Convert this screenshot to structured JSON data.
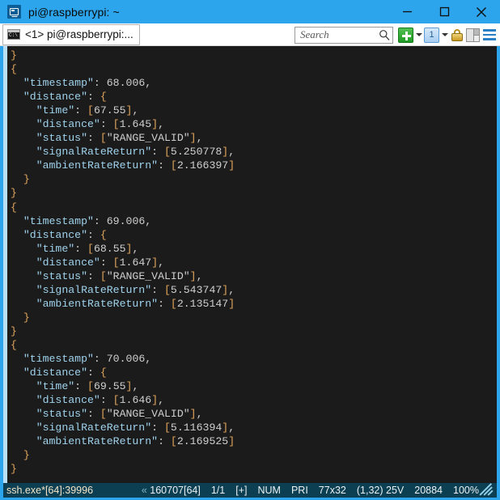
{
  "window": {
    "title": "pi@raspberrypi: ~",
    "icon": "mobaxterm-monitor-icon",
    "accent_color": "#2ca5ec",
    "controls": {
      "minimize_label": "minimize",
      "maximize_label": "maximize",
      "close_label": "close"
    }
  },
  "toolbar": {
    "tab": {
      "label": "<1> pi@raspberrypi:...",
      "icon": "console-window-icon"
    },
    "search": {
      "placeholder": "Search",
      "value": "",
      "icon": "search-icon"
    },
    "buttons": {
      "new_session_label": "+",
      "new_session_icon": "green-plus-icon",
      "new_session_caret_icon": "chevron-down-icon",
      "tab_count_label": "1",
      "tab_count_icon": "tab-count-icon",
      "tab_count_caret_icon": "chevron-down-icon",
      "lock_icon": "padlock-icon",
      "split_view_icon": "split-panel-icon",
      "menu_icon": "hamburger-menu-icon"
    }
  },
  "terminal": {
    "background_color": "#1b1b1b",
    "foreground_color": "#cfcfcf",
    "brace_color": "#e0a55c",
    "key_color": "#9fd2ec",
    "lines": [
      "}",
      "{",
      "  \"timestamp\": 68.006,",
      "  \"distance\": {",
      "    \"time\": [67.55],",
      "    \"distance\": [1.645],",
      "    \"status\": [\"RANGE_VALID\"],",
      "    \"signalRateReturn\": [5.250778],",
      "    \"ambientRateReturn\": [2.166397]",
      "  }",
      "}",
      "{",
      "  \"timestamp\": 69.006,",
      "  \"distance\": {",
      "    \"time\": [68.55],",
      "    \"distance\": [1.647],",
      "    \"status\": [\"RANGE_VALID\"],",
      "    \"signalRateReturn\": [5.543747],",
      "    \"ambientRateReturn\": [2.135147]",
      "  }",
      "}",
      "{",
      "  \"timestamp\": 70.006,",
      "  \"distance\": {",
      "    \"time\": [69.55],",
      "    \"distance\": [1.646],",
      "    \"status\": [\"RANGE_VALID\"],",
      "    \"signalRateReturn\": [5.116394],",
      "    \"ambientRateReturn\": [2.169525]",
      "  }",
      "}"
    ],
    "records": [
      {
        "timestamp": 68.006,
        "distance": {
          "time": [
            67.55
          ],
          "distance": [
            1.645
          ],
          "status": [
            "RANGE_VALID"
          ],
          "signalRateReturn": [
            5.250778
          ],
          "ambientRateReturn": [
            2.166397
          ]
        }
      },
      {
        "timestamp": 69.006,
        "distance": {
          "time": [
            68.55
          ],
          "distance": [
            1.647
          ],
          "status": [
            "RANGE_VALID"
          ],
          "signalRateReturn": [
            5.543747
          ],
          "ambientRateReturn": [
            2.135147
          ]
        }
      },
      {
        "timestamp": 70.006,
        "distance": {
          "time": [
            69.55
          ],
          "distance": [
            1.646
          ],
          "status": [
            "RANGE_VALID"
          ],
          "signalRateReturn": [
            5.116394
          ],
          "ambientRateReturn": [
            2.169525
          ]
        }
      }
    ]
  },
  "statusbar": {
    "process": "ssh.exe*[64]:39996",
    "build_prefix": "«",
    "build": "160707[64]",
    "session_count": "1/1",
    "insert_mode": "[+]",
    "num_lock": "NUM",
    "priority": "PRI",
    "size": "77x32",
    "cursor": "(1,32)",
    "voltage": "25V",
    "scrollback": "20884",
    "zoom": "100%",
    "grip_icon": "resize-grip-icon"
  }
}
